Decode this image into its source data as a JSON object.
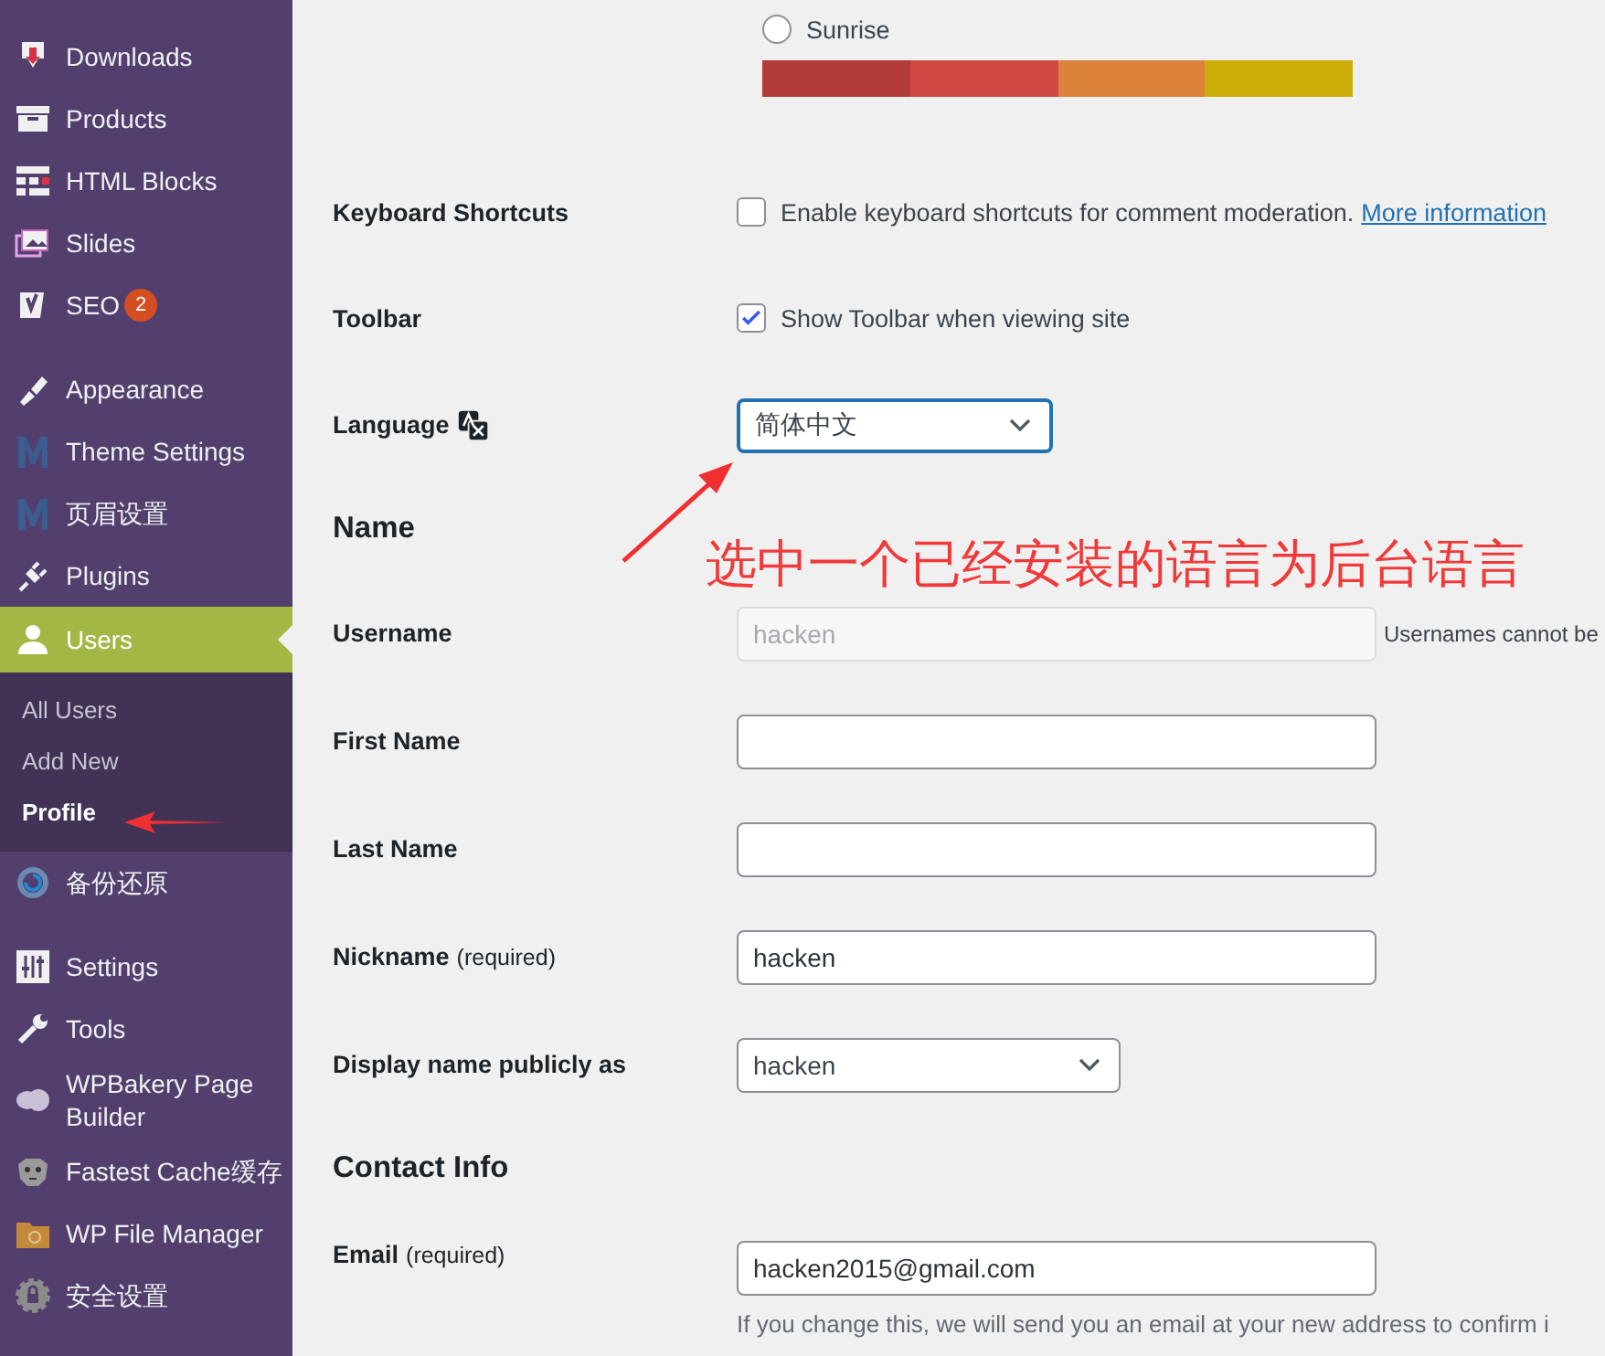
{
  "sidebar": {
    "items": [
      {
        "label": "Downloads",
        "selected": false
      },
      {
        "label": "Products",
        "selected": false
      },
      {
        "label": "HTML Blocks",
        "selected": false
      },
      {
        "label": "Slides",
        "selected": false
      },
      {
        "label": "SEO",
        "selected": false,
        "badge": "2"
      },
      {
        "label": "Appearance",
        "selected": false
      },
      {
        "label": "Theme Settings",
        "selected": false
      },
      {
        "label": "页眉设置",
        "selected": false
      },
      {
        "label": "Plugins",
        "selected": false
      },
      {
        "label": "Users",
        "selected": true,
        "children": [
          {
            "label": "All Users",
            "selected": false
          },
          {
            "label": "Add New",
            "selected": false
          },
          {
            "label": "Profile",
            "selected": true
          }
        ]
      },
      {
        "label": "备份还原",
        "selected": false
      },
      {
        "label": "Settings",
        "selected": false
      },
      {
        "label": "Tools",
        "selected": false
      },
      {
        "label": "WPBakery Page Builder",
        "selected": false
      },
      {
        "label": "Fastest Cache缓存",
        "selected": false
      },
      {
        "label": "WP File Manager",
        "selected": false
      },
      {
        "label": "安全设置",
        "selected": false
      }
    ]
  },
  "color_scheme": {
    "label": "Sunrise",
    "selected": false,
    "swatches": [
      {
        "color": "#b43c38"
      },
      {
        "color": "#cf4944"
      },
      {
        "color": "#dd823b"
      },
      {
        "color": "#ccaf0b"
      }
    ]
  },
  "rows": [
    {
      "kind": "checkbox",
      "label": "Keyboard Shortcuts",
      "text": "Enable keyboard shortcuts for comment moderation.",
      "link": "More information",
      "checked": false
    },
    {
      "kind": "checkbox",
      "label": "Toolbar",
      "text": "Show Toolbar when viewing site",
      "checked": true
    },
    {
      "kind": "select",
      "label": "Language",
      "label_icon": true,
      "value": "简体中文"
    },
    {
      "kind": "heading",
      "label": "Name"
    },
    {
      "kind": "input",
      "label": "Username",
      "value": "hacken",
      "disabled": true,
      "note": "Usernames cannot be"
    },
    {
      "kind": "input",
      "label": "First Name",
      "value": "",
      "disabled": false
    },
    {
      "kind": "input",
      "label": "Last Name",
      "value": "",
      "disabled": false
    },
    {
      "kind": "input",
      "label": "Nickname",
      "required": "(required)",
      "value": "hacken",
      "disabled": false
    },
    {
      "kind": "select",
      "label": "Display name publicly as",
      "value": "hacken"
    },
    {
      "kind": "heading",
      "label": "Contact Info"
    },
    {
      "kind": "input",
      "label": "Email",
      "required": "(required)",
      "value": "hacken2015@gmail.com",
      "disabled": false,
      "description": "If you change this, we will send you an email at your new address to confirm i"
    }
  ],
  "annotations": [
    {
      "kind": "callout",
      "text": "选中一个已经安装的语言为后台语言"
    },
    {
      "kind": "arrow_profile"
    }
  ]
}
